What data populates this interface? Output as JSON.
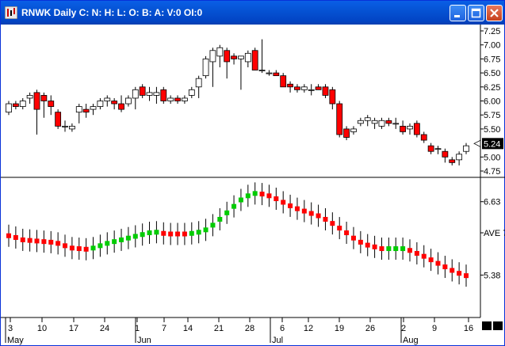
{
  "window": {
    "title": "RNWK Daily C: N: H: L: O: B: A: V:0 OI:0",
    "title_color": "#ffffff",
    "titlebar_color": "#0553d4"
  },
  "colors": {
    "down_candle": "#ff0000",
    "up_candle": "#ffffff",
    "avg_down": "#ff0000",
    "avg_up": "#00cc00",
    "axis": "#000000"
  },
  "price_axis": {
    "ticks": [
      "7.25",
      "7.00",
      "6.75",
      "6.50",
      "6.25",
      "6.00",
      "5.75",
      "5.50",
      "5.24",
      "5.00",
      "4.75"
    ],
    "last_price": "5.24"
  },
  "indicator_axis": {
    "ticks": [
      "6.63",
      "AVE 7",
      "5.38"
    ]
  },
  "x_axis": {
    "day_ticks": [
      "3",
      "10",
      "17",
      "24",
      "1",
      "7",
      "14",
      "21",
      "28",
      "6",
      "12",
      "19",
      "26",
      "2",
      "9",
      "16"
    ],
    "months": [
      "May",
      "Jun",
      "Jul",
      "Aug"
    ]
  },
  "chart_data": {
    "type": "candlestick",
    "title": "RNWK Daily",
    "price_ylim": [
      4.75,
      7.25
    ],
    "avg_label": "AVE 7",
    "avg_ylim": [
      4.9,
      6.95
    ],
    "candles": [
      [
        5.8,
        6.0,
        5.75,
        5.95
      ],
      [
        5.95,
        6.0,
        5.85,
        5.9
      ],
      [
        5.9,
        6.05,
        5.85,
        6.0
      ],
      [
        6.05,
        6.15,
        5.95,
        6.1
      ],
      [
        6.15,
        6.2,
        5.4,
        5.85
      ],
      [
        6.1,
        6.15,
        5.7,
        6.0
      ],
      [
        6.0,
        6.1,
        5.75,
        5.9
      ],
      [
        5.8,
        5.85,
        5.5,
        5.55
      ],
      [
        5.55,
        5.65,
        5.45,
        5.55
      ],
      [
        5.5,
        5.6,
        5.45,
        5.55
      ],
      [
        5.8,
        5.95,
        5.6,
        5.9
      ],
      [
        5.85,
        5.95,
        5.7,
        5.8
      ],
      [
        5.85,
        5.95,
        5.75,
        5.9
      ],
      [
        5.9,
        6.05,
        5.85,
        6.0
      ],
      [
        6.0,
        6.1,
        5.9,
        6.05
      ],
      [
        6.0,
        6.05,
        5.85,
        5.95
      ],
      [
        5.95,
        6.1,
        5.8,
        5.85
      ],
      [
        5.95,
        6.1,
        5.9,
        6.05
      ],
      [
        6.05,
        6.25,
        5.85,
        6.2
      ],
      [
        6.25,
        6.3,
        6.05,
        6.1
      ],
      [
        6.1,
        6.25,
        6.0,
        6.15
      ],
      [
        6.1,
        6.25,
        5.95,
        6.15
      ],
      [
        6.2,
        6.25,
        5.95,
        6.0
      ],
      [
        6.0,
        6.1,
        5.95,
        6.05
      ],
      [
        6.05,
        6.1,
        5.95,
        6.0
      ],
      [
        6.0,
        6.1,
        5.95,
        6.05
      ],
      [
        6.1,
        6.25,
        6.05,
        6.2
      ],
      [
        6.25,
        6.45,
        6.05,
        6.4
      ],
      [
        6.45,
        6.8,
        6.4,
        6.75
      ],
      [
        6.7,
        6.95,
        6.25,
        6.9
      ],
      [
        6.8,
        7.0,
        6.6,
        6.95
      ],
      [
        6.9,
        6.95,
        6.4,
        6.7
      ],
      [
        6.8,
        6.85,
        6.65,
        6.75
      ],
      [
        6.75,
        6.8,
        6.2,
        6.8
      ],
      [
        6.7,
        6.9,
        6.6,
        6.85
      ],
      [
        6.9,
        6.95,
        6.55,
        6.55
      ],
      [
        6.55,
        7.1,
        6.5,
        6.55
      ],
      [
        6.5,
        6.55,
        6.45,
        6.5
      ],
      [
        6.5,
        6.55,
        6.45,
        6.45
      ],
      [
        6.45,
        6.5,
        6.25,
        6.25
      ],
      [
        6.3,
        6.35,
        6.15,
        6.25
      ],
      [
        6.25,
        6.3,
        6.15,
        6.2
      ],
      [
        6.2,
        6.3,
        6.15,
        6.25
      ],
      [
        6.2,
        6.3,
        6.1,
        6.2
      ],
      [
        6.25,
        6.3,
        6.2,
        6.2
      ],
      [
        6.25,
        6.3,
        6.05,
        6.1
      ],
      [
        6.2,
        6.25,
        5.85,
        5.95
      ],
      [
        5.95,
        6.0,
        5.35,
        5.4
      ],
      [
        5.5,
        5.55,
        5.3,
        5.35
      ],
      [
        5.45,
        5.55,
        5.4,
        5.5
      ],
      [
        5.6,
        5.7,
        5.55,
        5.65
      ],
      [
        5.65,
        5.75,
        5.55,
        5.7
      ],
      [
        5.6,
        5.7,
        5.5,
        5.65
      ],
      [
        5.55,
        5.7,
        5.5,
        5.65
      ],
      [
        5.65,
        5.7,
        5.55,
        5.6
      ],
      [
        5.6,
        5.7,
        5.5,
        5.6
      ],
      [
        5.55,
        5.65,
        5.4,
        5.45
      ],
      [
        5.5,
        5.6,
        5.4,
        5.55
      ],
      [
        5.6,
        5.65,
        5.35,
        5.4
      ],
      [
        5.4,
        5.45,
        5.25,
        5.3
      ],
      [
        5.2,
        5.25,
        5.05,
        5.1
      ],
      [
        5.15,
        5.2,
        5.05,
        5.15
      ],
      [
        5.1,
        5.15,
        4.9,
        5.0
      ],
      [
        4.95,
        5.0,
        4.85,
        4.9
      ],
      [
        4.95,
        5.1,
        4.85,
        5.05
      ],
      [
        5.1,
        5.25,
        5.05,
        5.2
      ]
    ],
    "avg_values": [
      6.05,
      6.02,
      5.98,
      5.97,
      5.96,
      5.95,
      5.94,
      5.92,
      5.88,
      5.84,
      5.83,
      5.82,
      5.84,
      5.88,
      5.92,
      5.95,
      5.98,
      6.01,
      6.04,
      6.07,
      6.1,
      6.11,
      6.09,
      6.08,
      6.08,
      6.08,
      6.09,
      6.11,
      6.15,
      6.23,
      6.33,
      6.44,
      6.55,
      6.66,
      6.73,
      6.77,
      6.76,
      6.73,
      6.68,
      6.62,
      6.56,
      6.51,
      6.47,
      6.43,
      6.39,
      6.33,
      6.26,
      6.18,
      6.1,
      6.01,
      5.94,
      5.89,
      5.86,
      5.83,
      5.83,
      5.83,
      5.83,
      5.8,
      5.75,
      5.7,
      5.64,
      5.58,
      5.52,
      5.46,
      5.41,
      5.37
    ],
    "avg_dir": [
      "down",
      "down",
      "down",
      "down",
      "down",
      "down",
      "down",
      "down",
      "down",
      "down",
      "down",
      "down",
      "up",
      "up",
      "up",
      "up",
      "up",
      "up",
      "up",
      "up",
      "up",
      "up",
      "down",
      "down",
      "down",
      "down",
      "up",
      "up",
      "up",
      "up",
      "up",
      "up",
      "up",
      "up",
      "up",
      "up",
      "down",
      "down",
      "down",
      "down",
      "down",
      "down",
      "down",
      "down",
      "down",
      "down",
      "down",
      "down",
      "down",
      "down",
      "down",
      "down",
      "down",
      "down",
      "up",
      "up",
      "up",
      "down",
      "down",
      "down",
      "down",
      "down",
      "down",
      "down",
      "down",
      "down"
    ]
  }
}
